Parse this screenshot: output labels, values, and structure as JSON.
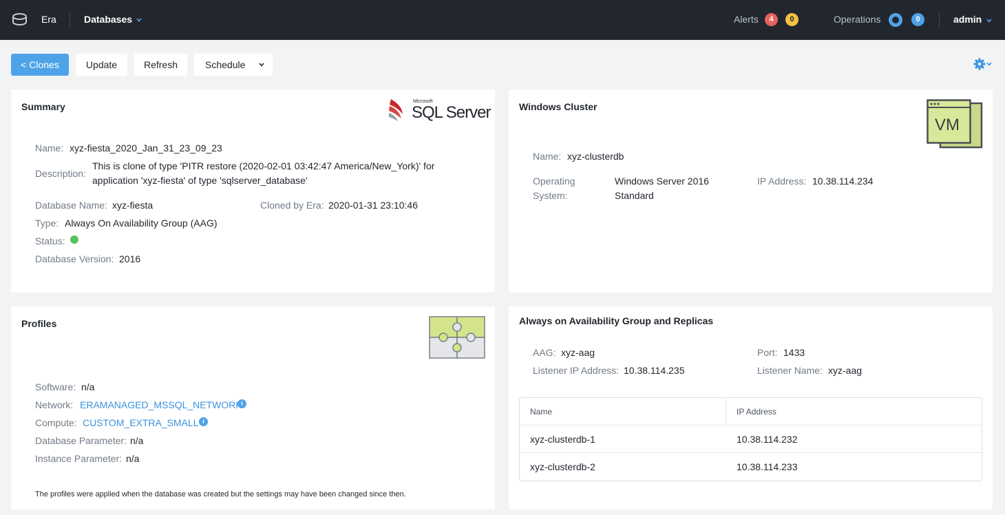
{
  "topbar": {
    "app_name": "Era",
    "menu_label": "Databases",
    "alerts_label": "Alerts",
    "alerts_critical": "4",
    "alerts_warning": "0",
    "operations_label": "Operations",
    "operations_count": "0",
    "user": "admin"
  },
  "toolbar": {
    "back_label": "< Clones",
    "update_label": "Update",
    "refresh_label": "Refresh",
    "schedule_label": "Schedule"
  },
  "summary": {
    "title": "Summary",
    "logo_brand": "Microsoft",
    "logo_product": "SQL Server",
    "name_label": "Name:",
    "name_value": "xyz-fiesta_2020_Jan_31_23_09_23",
    "description_label": "Description:",
    "description_line1": "This is clone of type 'PITR restore (2020-02-01 03:42:47 America/New_York)' for",
    "description_line2": "application 'xyz-fiesta' of type 'sqlserver_database'",
    "db_name_label": "Database Name:",
    "db_name_value": "xyz-fiesta",
    "cloned_label": "Cloned by Era:",
    "cloned_value": "2020-01-31 23:10:46",
    "type_label": "Type:",
    "type_value": "Always On Availability Group (AAG)",
    "status_label": "Status:",
    "status_color": "#57c25e",
    "version_label": "Database Version:",
    "version_value": "2016"
  },
  "windows_cluster": {
    "title": "Windows Cluster",
    "icon_text": "VM",
    "name_label": "Name:",
    "name_value": "xyz-clusterdb",
    "os_label_line1": "Operating",
    "os_label_line2": "System:",
    "os_value_line1": "Windows Server 2016",
    "os_value_line2": "Standard",
    "ip_label": "IP Address:",
    "ip_value": "10.38.114.234"
  },
  "profiles": {
    "title": "Profiles",
    "software_label": "Software:",
    "software_value": "n/a",
    "network_label": "Network:",
    "network_value": "ERAMANAGED_MSSQL_NETWORK",
    "compute_label": "Compute:",
    "compute_value": "CUSTOM_EXTRA_SMALL",
    "db_param_label": "Database Parameter:",
    "db_param_value": "n/a",
    "inst_param_label": "Instance Parameter:",
    "inst_param_value": "n/a",
    "info_glyph": "i",
    "footnote": "The profiles were applied when the database was created but the settings may have been changed since then."
  },
  "aag": {
    "title": "Always on Availability Group and Replicas",
    "aag_label": "AAG:",
    "aag_value": "xyz-aag",
    "port_label": "Port:",
    "port_value": "1433",
    "listener_ip_label": "Listener IP Address:",
    "listener_ip_value": "10.38.114.235",
    "listener_name_label": "Listener Name:",
    "listener_name_value": "xyz-aag",
    "table": {
      "headers": [
        "Name",
        "IP Address"
      ],
      "rows": [
        [
          "xyz-clusterdb-1",
          "10.38.114.232"
        ],
        [
          "xyz-clusterdb-2",
          "10.38.114.233"
        ]
      ]
    }
  }
}
